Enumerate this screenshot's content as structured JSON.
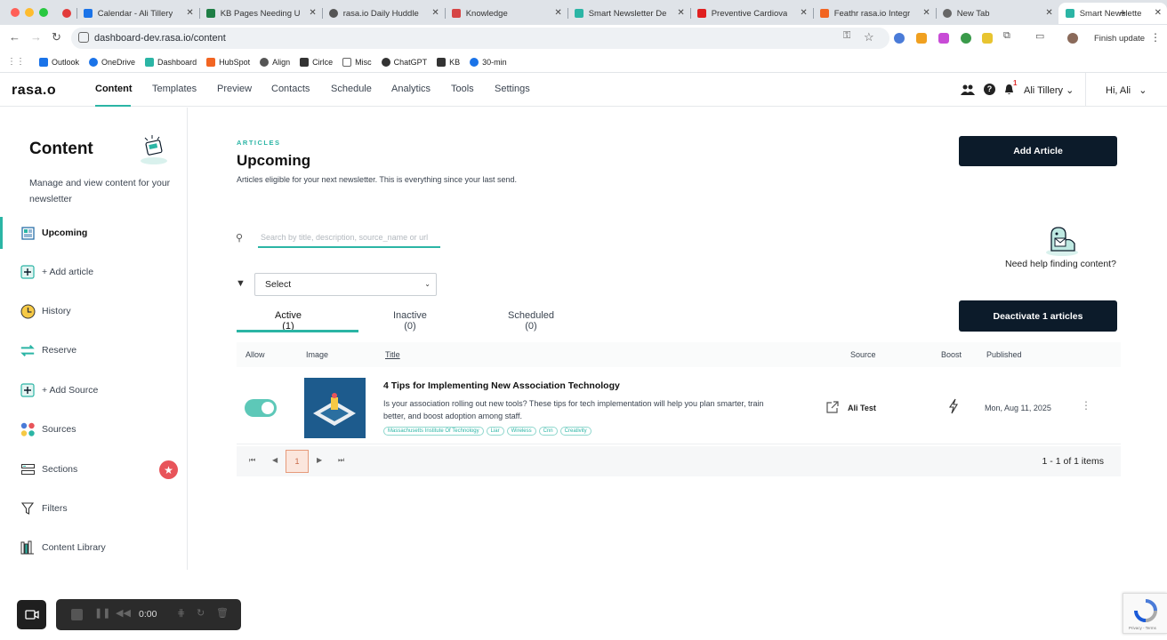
{
  "browser": {
    "tabs": [
      {
        "label": "",
        "color": "#e23a3a"
      },
      {
        "label": "Calendar - Ali Tillery",
        "color": "#1a73e8"
      },
      {
        "label": "KB Pages Needing U",
        "color": "#1e7e45"
      },
      {
        "label": "rasa.io Daily Huddle",
        "color": "#555555"
      },
      {
        "label": "Knowledge",
        "color": "#d64545"
      },
      {
        "label": "Smart Newsletter De",
        "color": "#2bb5a5"
      },
      {
        "label": "Preventive Cardiova",
        "color": "#e02020"
      },
      {
        "label": "Feathr rasa.io Integr",
        "color": "#f26522"
      },
      {
        "label": "New Tab",
        "color": "#666666"
      },
      {
        "label": "Smart Newslette",
        "color": "#2bb5a5"
      }
    ],
    "url": "dashboard-dev.rasa.io/content",
    "finish_update": "Finish update",
    "bookmarks": [
      {
        "label": "Outlook",
        "color": "#1a73e8"
      },
      {
        "label": "OneDrive",
        "color": "#1a73e8"
      },
      {
        "label": "Dashboard",
        "color": "#2bb5a5"
      },
      {
        "label": "HubSpot",
        "color": "#f26522"
      },
      {
        "label": "Align",
        "color": "#555555"
      },
      {
        "label": "Cirlce",
        "color": "#333333"
      },
      {
        "label": "Misc",
        "color": "#666666"
      },
      {
        "label": "ChatGPT",
        "color": "#333333"
      },
      {
        "label": "KB",
        "color": "#333333"
      },
      {
        "label": "30-min",
        "color": "#1a73e8"
      }
    ]
  },
  "app": {
    "logo": "rasa.o",
    "nav": [
      "Content",
      "Templates",
      "Preview",
      "Contacts",
      "Schedule",
      "Analytics",
      "Tools",
      "Settings"
    ],
    "notification_count": "1",
    "user_name": "Ali Tillery",
    "greeting": "Hi, Ali",
    "accent": "#2bb5a5",
    "dark_button": "#0c1b2a"
  },
  "sidebar": {
    "title": "Content",
    "description": "Manage and view content for your newsletter",
    "items": [
      {
        "label": "Upcoming",
        "icon": "newspaper-icon"
      },
      {
        "label": "+ Add article",
        "icon": "add-square-icon"
      },
      {
        "label": "History",
        "icon": "clock-icon"
      },
      {
        "label": "Reserve",
        "icon": "reserve-icon"
      },
      {
        "label": "+ Add Source",
        "icon": "add-square-icon"
      },
      {
        "label": "Sources",
        "icon": "sources-icon"
      },
      {
        "label": "Sections",
        "icon": "sections-icon"
      },
      {
        "label": "Filters",
        "icon": "filter-icon"
      },
      {
        "label": "Content Library",
        "icon": "library-icon"
      }
    ]
  },
  "main": {
    "kicker": "ARTICLES",
    "title": "Upcoming",
    "subtitle": "Articles eligible for your next newsletter. This is everything since your last send.",
    "add_article": "Add Article",
    "search_placeholder": "Search by title, description, source_name or url",
    "help_text": "Need help finding content?",
    "filter_select": "Select",
    "tabs": [
      "Active (1)",
      "Inactive (0)",
      "Scheduled (0)"
    ],
    "deactivate": "Deactivate 1 articles",
    "columns": {
      "allow": "Allow",
      "image": "Image",
      "title": "Title",
      "source": "Source",
      "boost": "Boost",
      "published": "Published"
    },
    "article": {
      "title": "4 Tips for Implementing New Association Technology",
      "description": "Is your association rolling out new tools? These tips for tech implementation will help you plan smarter, train better, and boost adoption among staff.",
      "tags": [
        "Massachusetts Institute Of Technology",
        "Liar",
        "Wireless",
        "Cnn",
        "Creativity"
      ],
      "source": "Ali Test",
      "published": "Mon, Aug 11, 2025",
      "allowed": true
    },
    "pagination": {
      "current": "1",
      "info": "1 - 1 of 1 items"
    }
  },
  "recorder": {
    "time": "0:00"
  },
  "recaptcha": {
    "terms": "Privacy - Terms"
  }
}
